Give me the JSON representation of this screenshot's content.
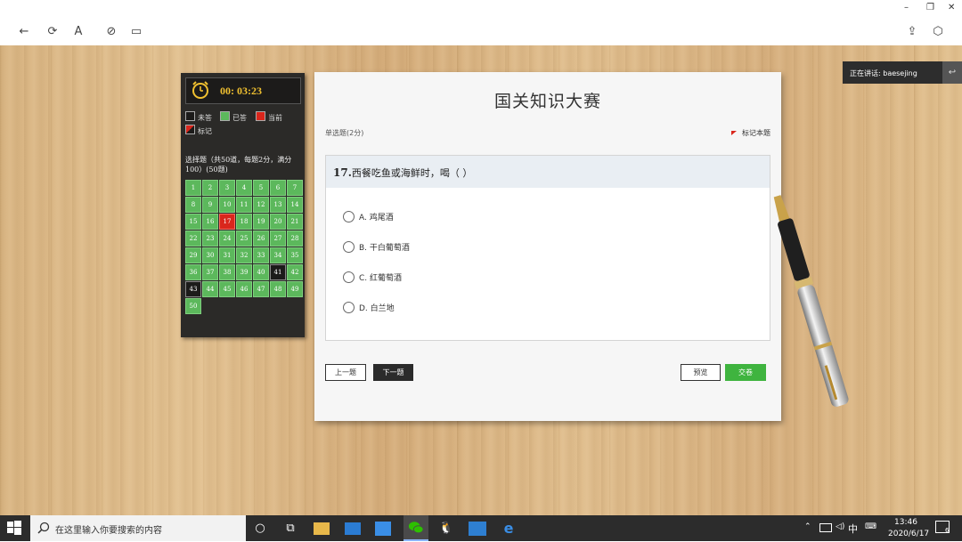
{
  "window": {
    "minimize": "–",
    "restore": "❐",
    "close": "✕"
  },
  "toolbar": {
    "back": "←",
    "refresh": "⟳",
    "font": "A",
    "link": "⊘",
    "layout": "▭",
    "share": "⇪",
    "cube": "⬡"
  },
  "timer": {
    "value": "00: 03:23"
  },
  "legend": {
    "unanswered": "未答",
    "answered": "已答",
    "current": "当前",
    "marked": "标记"
  },
  "section": {
    "title": "选择题（共50道，每题2分，满分100）(50题)"
  },
  "grid": {
    "current": 17,
    "unanswered": [
      41,
      43
    ],
    "numbers": [
      "1",
      "2",
      "3",
      "4",
      "5",
      "6",
      "7",
      "8",
      "9",
      "10",
      "11",
      "12",
      "13",
      "14",
      "15",
      "16",
      "17",
      "18",
      "19",
      "20",
      "21",
      "22",
      "23",
      "24",
      "25",
      "26",
      "27",
      "28",
      "29",
      "30",
      "31",
      "32",
      "33",
      "34",
      "35",
      "36",
      "37",
      "38",
      "39",
      "40",
      "41",
      "42",
      "43",
      "44",
      "45",
      "46",
      "47",
      "48",
      "49",
      "50"
    ]
  },
  "card": {
    "title": "国关知识大赛",
    "qtype": "单选题(2分)",
    "mark": "标记本题",
    "qnum": "17.",
    "question": "西餐吃鱼或海鲜时，喝（  ）",
    "options": [
      {
        "label": "A.  鸡尾酒"
      },
      {
        "label": "B.  干白葡萄酒"
      },
      {
        "label": "C.  红葡萄酒"
      },
      {
        "label": "D.  白兰地"
      }
    ],
    "buttons": {
      "prev": "上一题",
      "next": "下一题",
      "preview": "预览",
      "submit": "交卷"
    }
  },
  "speaking": {
    "label": "正在讲话: baesejing"
  },
  "taskbar": {
    "search_placeholder": "在这里输入你要搜索的内容",
    "time": "13:46",
    "date": "2020/6/17",
    "ime": "中",
    "notifications": "6"
  },
  "colors": {
    "answered": "#5cb85c",
    "current": "#d9261c",
    "submit": "#3fb43f"
  }
}
